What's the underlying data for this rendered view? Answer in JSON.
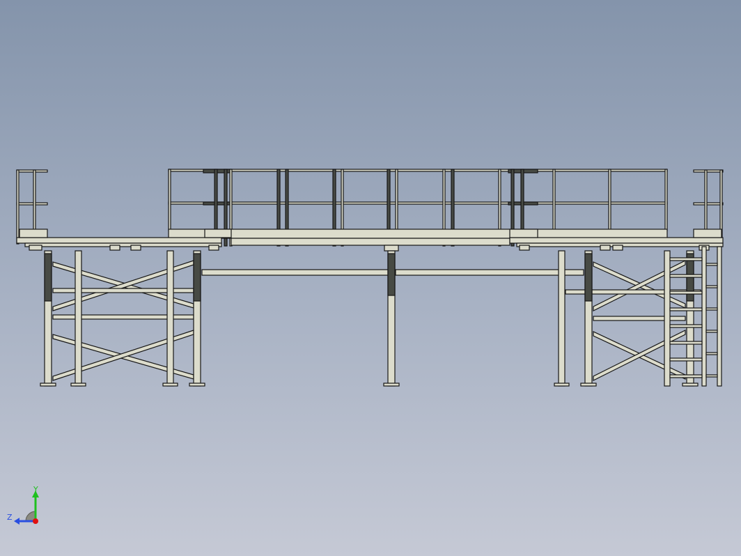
{
  "view": {
    "background_top": "#8494ab",
    "background_bottom": "#c5c9d5",
    "steel_fill": "#dcdccc",
    "steel_shade": "#474a44",
    "edge_color": "#161616"
  },
  "model": {
    "name": "",
    "view_orientation": "right side view",
    "components": [
      "platform-deck",
      "guardrails",
      "support-columns",
      "cross-bracing",
      "tie-beam",
      "access-ladder"
    ]
  },
  "triad": {
    "y_label": "Y",
    "z_label": "Z",
    "y_color": "#1fc01f",
    "z_color": "#2a4fe0",
    "x_color": "#e01010"
  }
}
